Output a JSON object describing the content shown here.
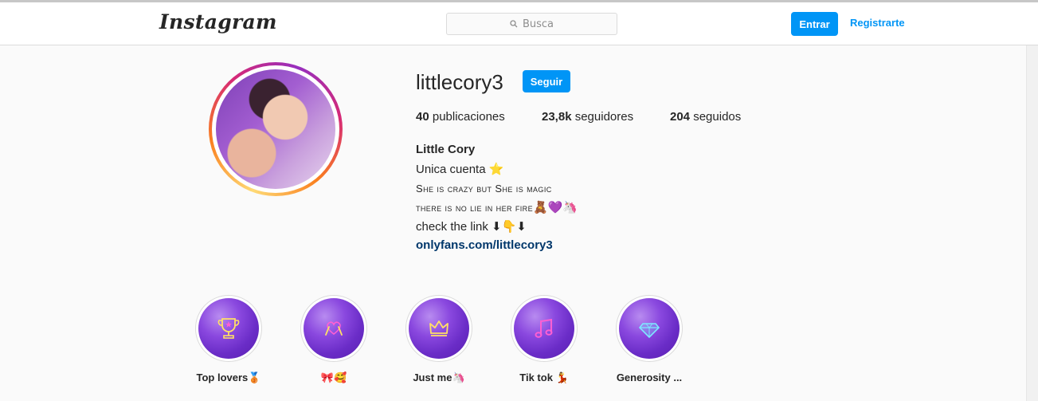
{
  "header": {
    "logo": "Instagram",
    "search_placeholder": "Busca",
    "login_label": "Entrar",
    "signup_label": "Registrarte"
  },
  "profile": {
    "username": "littlecory3",
    "follow_label": "Seguir",
    "stats": {
      "posts_count": "40",
      "posts_label": "publicaciones",
      "followers_count": "23,8k",
      "followers_label": "seguidores",
      "following_count": "204",
      "following_label": "seguidos"
    },
    "bio": {
      "name": "Little Cory",
      "line1": "Unica cuenta ⭐",
      "line2": "She is crazy but She is magic",
      "line3": "there is no lie in her fire",
      "line3_emoji": "🧸💜🦄",
      "line4": "check the link ⬇👇⬇",
      "link": "onlyfans.com/littlecory3"
    }
  },
  "highlights": [
    {
      "label": "Top lovers🥉",
      "icon": "trophy-icon"
    },
    {
      "label": "🎀🥰",
      "icon": "heart-hands-icon"
    },
    {
      "label": "Just me🦄",
      "icon": "crown-icon"
    },
    {
      "label": "Tik tok 💃",
      "icon": "music-note-icon"
    },
    {
      "label": "Generosity ...",
      "icon": "diamond-icon"
    }
  ],
  "colors": {
    "primary_blue": "#0095f6",
    "link_blue": "#00376b",
    "highlight_purple": "#8a48df",
    "neon_yellow": "#ffe066",
    "neon_pink": "#ff5fd2"
  }
}
